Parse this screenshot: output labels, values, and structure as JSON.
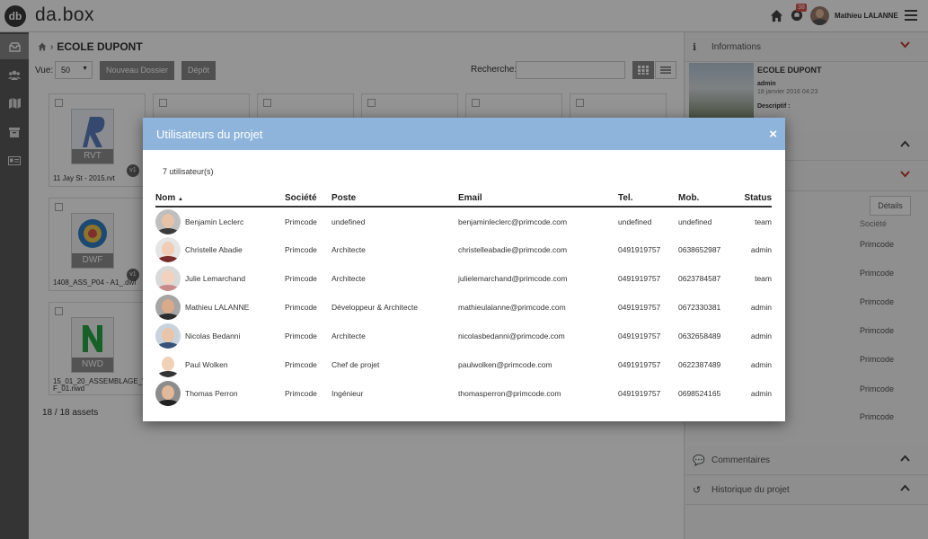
{
  "app": {
    "logo_initials": "db",
    "logo_text": "da.box"
  },
  "topbar": {
    "notifications_badge": "38",
    "user_name": "Mathieu LALANNE"
  },
  "main": {
    "breadcrumb": "ECOLE DUPONT",
    "vue_label": "Vue:",
    "vue_value": "50",
    "new_folder_label": "Nouveau Dossier",
    "depot_label": "Dépôt",
    "search_label": "Recherche:",
    "files": [
      {
        "name": "11 Jay St - 2015.rvt",
        "type": "RVT",
        "version": "v1"
      },
      {
        "name": "1408_ASS_P04 - A1_.dwf",
        "type": "DWF",
        "version": "v1"
      },
      {
        "name": "15_01_20_ASSEMBLAGE_VC F_01.nwd",
        "type": "NWD",
        "version": "v1"
      }
    ],
    "assets_count": "18 / 18 assets"
  },
  "right_panel": {
    "info_label": "Informations",
    "project_name": "ECOLE DUPONT",
    "project_admin": "admin",
    "project_date": "18 janvier 2016 04:23",
    "project_desc_label": "Descriptif :",
    "details_label": "Détails",
    "societe_header": "Société",
    "societe_values": [
      "Primcode",
      "Primcode",
      "Primcode",
      "Primcode",
      "Primcode",
      "Primcode",
      "Primcode"
    ],
    "comments_label": "Commentaires",
    "history_label": "Historique du projet"
  },
  "modal": {
    "title": "Utilisateurs du projet",
    "close_glyph": "×",
    "count_text": "7 utilisateur(s)",
    "columns": [
      "Nom",
      "Société",
      "Poste",
      "Email",
      "Tel.",
      "Mob.",
      "Status"
    ],
    "sort_glyph": "▲",
    "users": [
      {
        "name": "Benjamin Leclerc",
        "societe": "Primcode",
        "poste": "undefined",
        "email": "benjaminleclerc@primcode.com",
        "tel": "undefined",
        "mob": "undefined",
        "status": "team"
      },
      {
        "name": "Christelle Abadie",
        "societe": "Primcode",
        "poste": "Architecte",
        "email": "christelleabadie@primcode.com",
        "tel": "0491919757",
        "mob": "0638652987",
        "status": "admin"
      },
      {
        "name": "Julie Lemarchand",
        "societe": "Primcode",
        "poste": "Architecte",
        "email": "julielemarchand@primcode.com",
        "tel": "0491919757",
        "mob": "0623784587",
        "status": "team"
      },
      {
        "name": "Mathieu LALANNE",
        "societe": "Primcode",
        "poste": "Développeur & Architecte",
        "email": "mathieulalanne@primcode.com",
        "tel": "0491919757",
        "mob": "0672330381",
        "status": "admin"
      },
      {
        "name": "Nicolas Bedanni",
        "societe": "Primcode",
        "poste": "Architecte",
        "email": "nicolasbedanni@primcode.com",
        "tel": "0491919757",
        "mob": "0632658489",
        "status": "admin"
      },
      {
        "name": "Paul Wolken",
        "societe": "Primcode",
        "poste": "Chef de projet",
        "email": "paulwolken@primcode.com",
        "tel": "0491919757",
        "mob": "0622387489",
        "status": "admin"
      },
      {
        "name": "Thomas Perron",
        "societe": "Primcode",
        "poste": "Ingénieur",
        "email": "thomasperron@primcode.com",
        "tel": "0491919757",
        "mob": "0698524165",
        "status": "admin"
      }
    ]
  },
  "colors": {
    "modal_header": "#8eb4dc",
    "chevron_red": "#c0392b",
    "badge_red": "#d9534f"
  }
}
